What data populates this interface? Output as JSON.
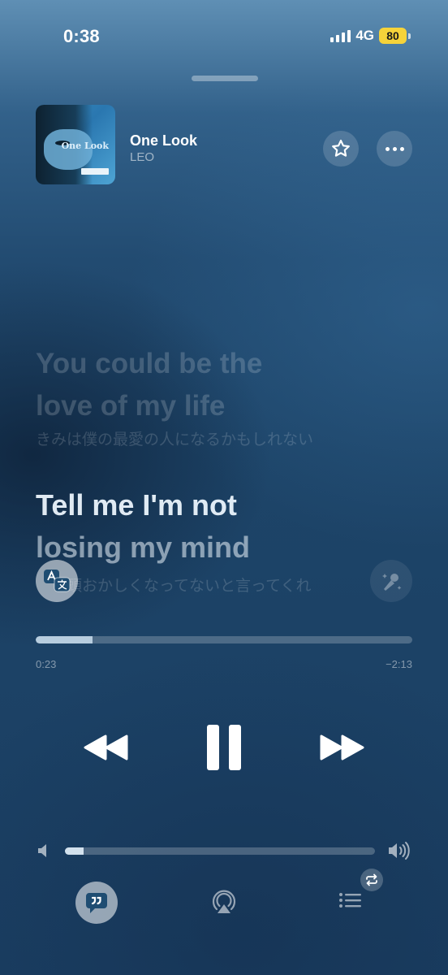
{
  "status_bar": {
    "time": "0:38",
    "network": "4G",
    "battery": "80",
    "battery_color": "#f6d33a"
  },
  "now_playing": {
    "title": "One Look",
    "artist": "LEO",
    "artwork_text": "One Look",
    "favorite_icon": "star-icon",
    "more_icon": "ellipsis-icon"
  },
  "lyrics": {
    "previous_line": [
      "You could be the",
      "love of my life"
    ],
    "previous_translation": "きみは僕の最愛の人になるかもしれない",
    "current_line": [
      "Tell me I'm not",
      "losing my mind"
    ],
    "current_translation": "頭おかしくなってないと言ってくれ",
    "translate_icon": "translate-icon",
    "sing_icon": "microphone-sparkle-icon"
  },
  "playback": {
    "elapsed": "0:23",
    "remaining": "−2:13",
    "progress": 0.15,
    "volume": 0.06,
    "state": "playing",
    "controls": [
      "rewind-icon",
      "pause-icon",
      "fast-forward-icon"
    ]
  },
  "bottom_bar": {
    "items": [
      "lyrics-icon",
      "airplay-icon",
      "queue-icon"
    ],
    "repeat_badge": "repeat-icon"
  }
}
